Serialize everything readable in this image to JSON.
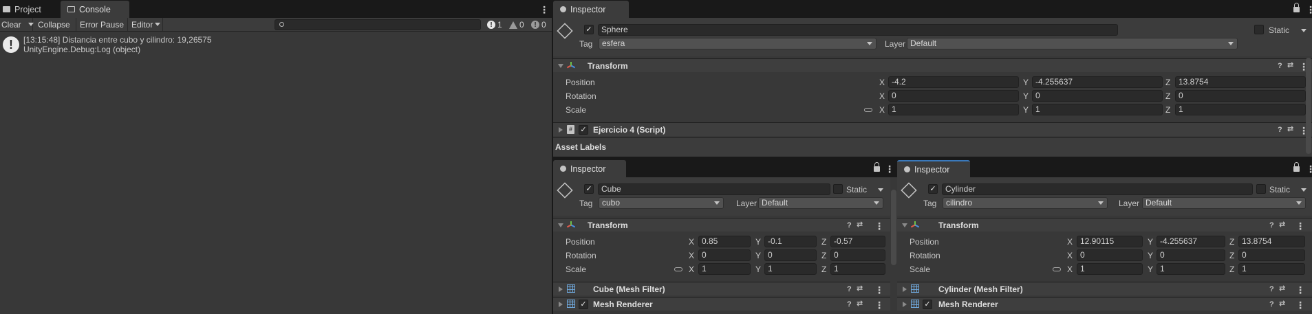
{
  "left": {
    "tabs": [
      {
        "label": "Project"
      },
      {
        "label": "Console"
      }
    ],
    "toolbar": {
      "clear": "Clear",
      "collapse": "Collapse",
      "error_pause": "Error Pause",
      "editor": "Editor",
      "counts": {
        "log": "1",
        "warn": "0",
        "error": "0"
      }
    },
    "log": {
      "line1": "[13:15:48] Distancia entre cubo y cilindro: 19,26575",
      "line2": "UnityEngine.Debug:Log (object)"
    }
  },
  "top": {
    "tab": "Inspector",
    "name": "Sphere",
    "static": "Static",
    "tag_label": "Tag",
    "tag": "esfera",
    "layer_label": "Layer",
    "layer": "Default",
    "transform": "Transform",
    "position_label": "Position",
    "rotation_label": "Rotation",
    "scale_label": "Scale",
    "pos": {
      "x": "-4.2",
      "y": "-4.255637",
      "z": "13.8754"
    },
    "rot": {
      "x": "0",
      "y": "0",
      "z": "0"
    },
    "scl": {
      "x": "1",
      "y": "1",
      "z": "1"
    },
    "script": "Ejercicio 4 (Script)",
    "asset_labels": "Asset Labels"
  },
  "cube": {
    "tab": "Inspector",
    "name": "Cube",
    "static": "Static",
    "tag_label": "Tag",
    "tag": "cubo",
    "layer_label": "Layer",
    "layer": "Default",
    "transform": "Transform",
    "position_label": "Position",
    "rotation_label": "Rotation",
    "scale_label": "Scale",
    "pos": {
      "x": "0.85",
      "y": "-0.1",
      "z": "-0.57"
    },
    "rot": {
      "x": "0",
      "y": "0",
      "z": "0"
    },
    "scl": {
      "x": "1",
      "y": "1",
      "z": "1"
    },
    "mesh_filter": "Cube (Mesh Filter)",
    "mesh_renderer": "Mesh Renderer"
  },
  "cylinder": {
    "tab": "Inspector",
    "name": "Cylinder",
    "static": "Static",
    "tag_label": "Tag",
    "tag": "cilindro",
    "layer_label": "Layer",
    "layer": "Default",
    "transform": "Transform",
    "position_label": "Position",
    "rotation_label": "Rotation",
    "scale_label": "Scale",
    "pos": {
      "x": "12.90115",
      "y": "-4.255637",
      "z": "13.8754"
    },
    "rot": {
      "x": "0",
      "y": "0",
      "z": "0"
    },
    "scl": {
      "x": "1",
      "y": "1",
      "z": "1"
    },
    "mesh_filter": "Cylinder (Mesh Filter)",
    "mesh_renderer": "Mesh Renderer"
  },
  "axes": {
    "x": "X",
    "y": "Y",
    "z": "Z"
  }
}
